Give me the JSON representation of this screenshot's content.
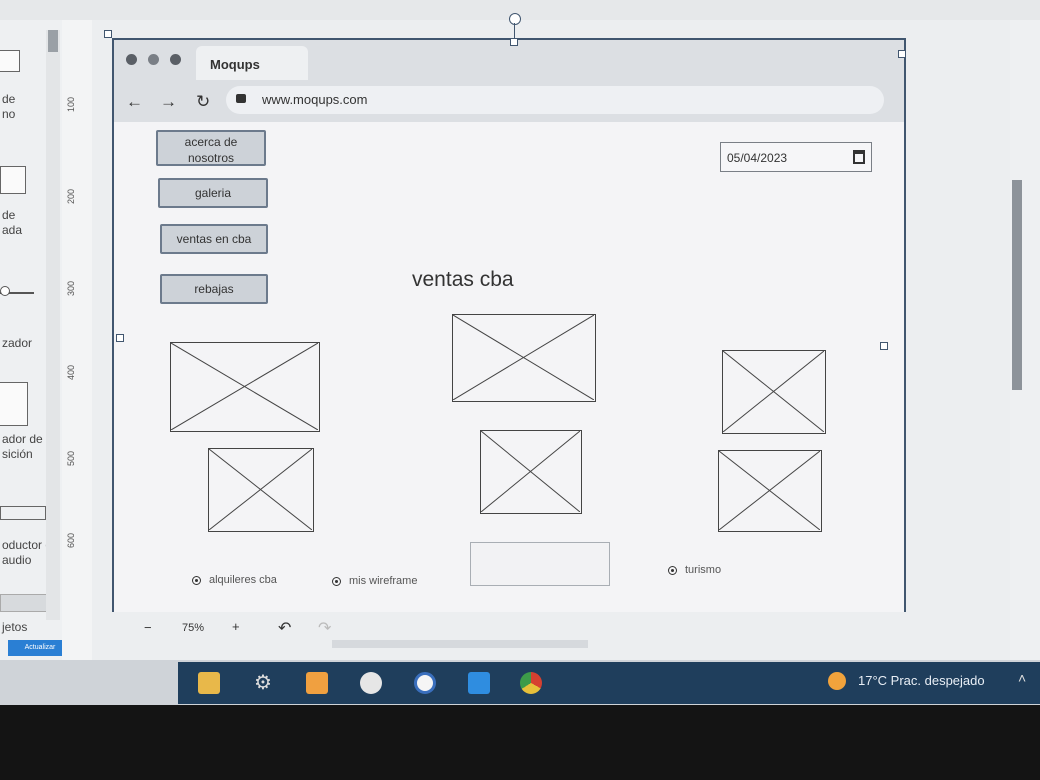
{
  "left_panel": {
    "items": [
      {
        "label": "de\nno"
      },
      {
        "label": "de\nada"
      },
      {
        "label": "zador"
      },
      {
        "label": "ador de\nsición"
      },
      {
        "label": "oductor de\naudio"
      },
      {
        "label": "jetos"
      }
    ],
    "actualizar_label": "Actualizar"
  },
  "ruler": {
    "ticks": [
      "100",
      "200",
      "300",
      "400",
      "500",
      "600"
    ]
  },
  "browser": {
    "tab_title": "Moqups",
    "url": "www.moqups.com"
  },
  "wireframe": {
    "nav_buttons": [
      {
        "label": "acerca de\nnosotros"
      },
      {
        "label": "galeria"
      },
      {
        "label": "ventas en cba"
      },
      {
        "label": "rebajas"
      }
    ],
    "date_value": "05/04/2023",
    "heading": "ventas cba",
    "radios": [
      {
        "label": "alquileres cba"
      },
      {
        "label": "mis wireframe"
      },
      {
        "label": "turismo"
      }
    ]
  },
  "toolbar": {
    "zoom": "75%",
    "minus": "−",
    "plus": "+"
  },
  "taskbar": {
    "weather": "17°C  Prac. despejado",
    "icons": [
      "file-explorer-icon",
      "settings-icon",
      "sticky-notes-icon",
      "emoji-icon",
      "remote-app-icon",
      "vscode-icon",
      "chrome-icon"
    ]
  }
}
